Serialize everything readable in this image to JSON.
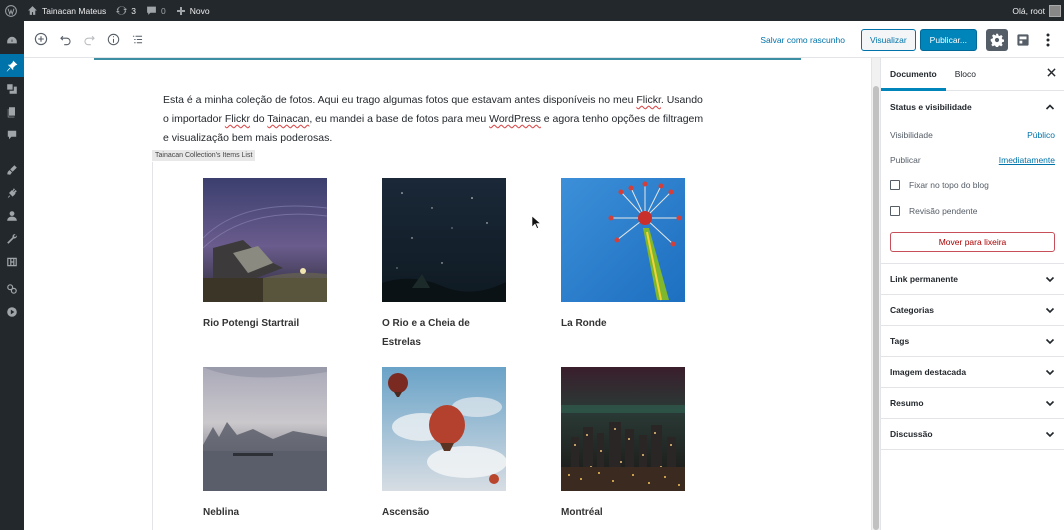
{
  "adminbar": {
    "site_name": "Tainacan Mateus",
    "updates_count": "3",
    "comments_count": "0",
    "new_label": "Novo",
    "greeting": "Olá, root"
  },
  "toolbar": {
    "save_draft_label": "Salvar como rascunho",
    "preview_label": "Visualizar",
    "publish_label": "Publicar..."
  },
  "content": {
    "intro_parts": [
      "Esta é a minha coleção de fotos. Aqui eu trago algumas fotos que estavam antes disponíveis no meu ",
      "Flickr",
      ". Usando o importador ",
      "Flickr",
      " do ",
      "Tainacan",
      ", eu mandei a base de fotos para meu ",
      "WordPress",
      " e agora tenho opções de filtragem e visualização bem mais poderosas."
    ],
    "block_label": "Tainacan Collection's Items List",
    "items": [
      {
        "caption": "Rio Potengi Startrail"
      },
      {
        "caption": "O Rio e a Cheia de Estrelas"
      },
      {
        "caption": "La Ronde"
      },
      {
        "caption": "Neblina"
      },
      {
        "caption": "Ascensão"
      },
      {
        "caption": "Montréal"
      }
    ]
  },
  "sidebar": {
    "tab_document": "Documento",
    "tab_block": "Bloco",
    "status_title": "Status e visibilidade",
    "visibility_label": "Visibilidade",
    "visibility_value": "Público",
    "publish_label": "Publicar",
    "publish_value": "Imediatamente",
    "sticky_label": "Fixar no topo do blog",
    "pending_label": "Revisão pendente",
    "trash_label": "Mover para lixeira",
    "panels": [
      {
        "label": "Link permanente"
      },
      {
        "label": "Categorias"
      },
      {
        "label": "Tags"
      },
      {
        "label": "Imagem destacada"
      },
      {
        "label": "Resumo"
      },
      {
        "label": "Discussão"
      }
    ]
  },
  "colors": {
    "admin_dark": "#23282d",
    "accent": "#0085ba",
    "link": "#0073aa",
    "trash": "#a00"
  }
}
